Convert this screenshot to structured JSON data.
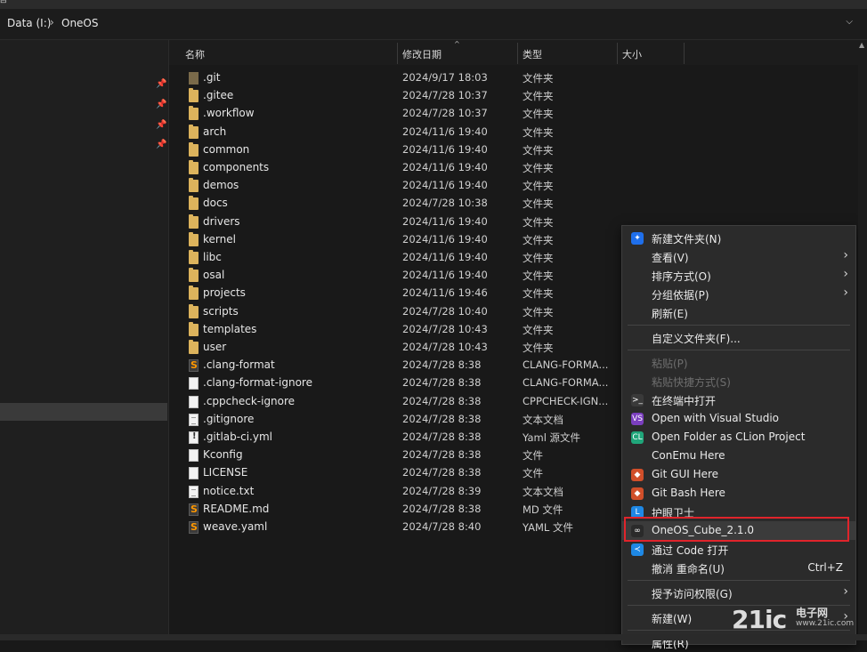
{
  "titlebar": {
    "glyph": "⊟"
  },
  "address": {
    "crumbs": [
      "Data (I:)",
      "OneOS"
    ],
    "separator": "›",
    "dropdown": "⌵"
  },
  "sidebar": {
    "pin_glyph": "📌"
  },
  "columns": {
    "name": "名称",
    "date": "修改日期",
    "type": "类型",
    "size": "大小",
    "sort_glyph": "^"
  },
  "files": [
    {
      "name": ".git",
      "date": "2024/9/17 18:03",
      "type": "文件夹",
      "icon": "gitfolder"
    },
    {
      "name": ".gitee",
      "date": "2024/7/28 10:37",
      "type": "文件夹",
      "icon": "folder"
    },
    {
      "name": ".workflow",
      "date": "2024/7/28 10:37",
      "type": "文件夹",
      "icon": "folder"
    },
    {
      "name": "arch",
      "date": "2024/11/6 19:40",
      "type": "文件夹",
      "icon": "folder"
    },
    {
      "name": "common",
      "date": "2024/11/6 19:40",
      "type": "文件夹",
      "icon": "folder"
    },
    {
      "name": "components",
      "date": "2024/11/6 19:40",
      "type": "文件夹",
      "icon": "folder"
    },
    {
      "name": "demos",
      "date": "2024/11/6 19:40",
      "type": "文件夹",
      "icon": "folder"
    },
    {
      "name": "docs",
      "date": "2024/7/28 10:38",
      "type": "文件夹",
      "icon": "folder"
    },
    {
      "name": "drivers",
      "date": "2024/11/6 19:40",
      "type": "文件夹",
      "icon": "folder"
    },
    {
      "name": "kernel",
      "date": "2024/11/6 19:40",
      "type": "文件夹",
      "icon": "folder"
    },
    {
      "name": "libc",
      "date": "2024/11/6 19:40",
      "type": "文件夹",
      "icon": "folder"
    },
    {
      "name": "osal",
      "date": "2024/11/6 19:40",
      "type": "文件夹",
      "icon": "folder"
    },
    {
      "name": "projects",
      "date": "2024/11/6 19:46",
      "type": "文件夹",
      "icon": "folder"
    },
    {
      "name": "scripts",
      "date": "2024/7/28 10:40",
      "type": "文件夹",
      "icon": "folder"
    },
    {
      "name": "templates",
      "date": "2024/7/28 10:43",
      "type": "文件夹",
      "icon": "folder"
    },
    {
      "name": "user",
      "date": "2024/7/28 10:43",
      "type": "文件夹",
      "icon": "folder"
    },
    {
      "name": ".clang-format",
      "date": "2024/7/28 8:38",
      "type": "CLANG-FORMA...",
      "icon": "sublime"
    },
    {
      "name": ".clang-format-ignore",
      "date": "2024/7/28 8:38",
      "type": "CLANG-FORMA...",
      "icon": "file"
    },
    {
      "name": ".cppcheck-ignore",
      "date": "2024/7/28 8:38",
      "type": "CPPCHECK-IGN...",
      "icon": "file"
    },
    {
      "name": ".gitignore",
      "date": "2024/7/28 8:38",
      "type": "文本文档",
      "icon": "text"
    },
    {
      "name": ".gitlab-ci.yml",
      "date": "2024/7/28 8:38",
      "type": "Yaml 源文件",
      "icon": "file yml"
    },
    {
      "name": "Kconfig",
      "date": "2024/7/28 8:38",
      "type": "文件",
      "icon": "file"
    },
    {
      "name": "LICENSE",
      "date": "2024/7/28 8:38",
      "type": "文件",
      "icon": "file"
    },
    {
      "name": "notice.txt",
      "date": "2024/7/28 8:39",
      "type": "文本文档",
      "icon": "text"
    },
    {
      "name": "README.md",
      "date": "2024/7/28 8:38",
      "type": "MD 文件",
      "icon": "sublime"
    },
    {
      "name": "weave.yaml",
      "date": "2024/7/28 8:40",
      "type": "YAML 文件",
      "icon": "sublime"
    }
  ],
  "context_menu": {
    "items": [
      {
        "label": "新建文件夹(N)",
        "icon": "new-folder-icon",
        "glyph": "✦",
        "color": "#1f6feb"
      },
      {
        "label": "查看(V)",
        "arrow": "›"
      },
      {
        "label": "排序方式(O)",
        "arrow": "›"
      },
      {
        "label": "分组依据(P)",
        "arrow": "›"
      },
      {
        "label": "刷新(E)"
      },
      {
        "separator": true
      },
      {
        "label": "自定义文件夹(F)..."
      },
      {
        "separator": true
      },
      {
        "label": "粘贴(P)",
        "disabled": true
      },
      {
        "label": "粘贴快捷方式(S)",
        "disabled": true
      },
      {
        "label": "在终端中打开",
        "icon": "terminal-icon",
        "glyph": ">_",
        "color": "#3a3a3a"
      },
      {
        "label": "Open with Visual Studio",
        "icon": "visual-studio-icon",
        "glyph": "VS",
        "color": "#7b3fbf"
      },
      {
        "label": "Open Folder as CLion Project",
        "icon": "clion-icon",
        "glyph": "CL",
        "color": "#20a67a"
      },
      {
        "label": "ConEmu Here"
      },
      {
        "label": "Git GUI Here",
        "icon": "git-gui-icon",
        "glyph": "◆",
        "color": "#d14f2a"
      },
      {
        "label": "Git Bash Here",
        "icon": "git-bash-icon",
        "glyph": "◆",
        "color": "#d14f2a"
      },
      {
        "label": "护眼卫士",
        "icon": "eye-guard-icon",
        "glyph": "L",
        "color": "#1e88e5"
      },
      {
        "label": "OneOS_Cube_2.1.0",
        "icon": "oneos-cube-icon",
        "glyph": "∞",
        "color": "#2a2a2a",
        "highlight": true
      },
      {
        "label": "通过 Code 打开",
        "icon": "vscode-icon",
        "glyph": "≺",
        "color": "#1e88e5"
      },
      {
        "label": "撤消 重命名(U)",
        "shortcut": "Ctrl+Z"
      },
      {
        "separator": true
      },
      {
        "label": "授予访问权限(G)",
        "arrow": "›"
      },
      {
        "separator": true
      },
      {
        "label": "新建(W)",
        "arrow": "›"
      },
      {
        "separator": true
      },
      {
        "label": "属性(R)"
      }
    ]
  },
  "watermark": {
    "big": "21ic",
    "cn": "电子网",
    "url": "www.21ic.com"
  }
}
